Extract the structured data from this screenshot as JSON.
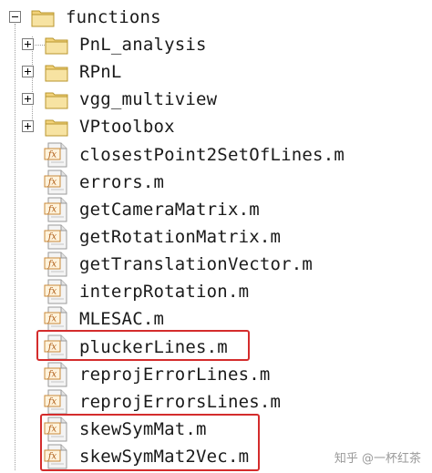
{
  "root": {
    "label": "functions",
    "expanded": true
  },
  "folders": [
    {
      "label": "PnL_analysis",
      "expanded": false
    },
    {
      "label": "RPnL",
      "expanded": false
    },
    {
      "label": "vgg_multiview",
      "expanded": false
    },
    {
      "label": "VPtoolbox",
      "expanded": false
    }
  ],
  "files": [
    {
      "label": "closestPoint2SetOfLines.m"
    },
    {
      "label": "errors.m"
    },
    {
      "label": "getCameraMatrix.m"
    },
    {
      "label": "getRotationMatrix.m"
    },
    {
      "label": "getTranslationVector.m"
    },
    {
      "label": "interpRotation.m"
    },
    {
      "label": "MLESAC.m"
    },
    {
      "label": "pluckerLines.m"
    },
    {
      "label": "reprojErrorLines.m"
    },
    {
      "label": "reprojErrorsLines.m"
    },
    {
      "label": "skewSymMat.m"
    },
    {
      "label": "skewSymMat2Vec.m"
    }
  ],
  "watermark": "知乎 @一杯红茶",
  "colors": {
    "highlight": "#d42c2c",
    "folder": "#f2d27a"
  },
  "icons": {
    "folder": "folder-icon",
    "matlab_file": "matlab-file-icon",
    "expand": "expand-plus-icon",
    "collapse": "collapse-minus-icon"
  }
}
